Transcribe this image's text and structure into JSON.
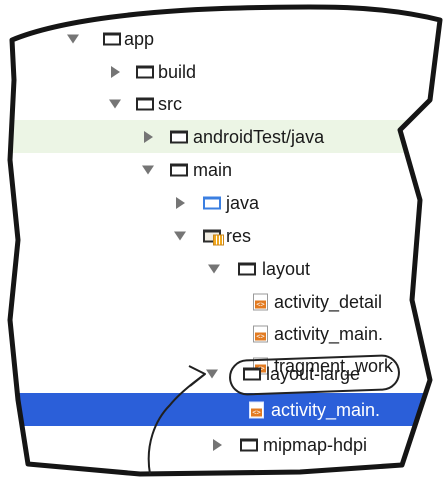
{
  "tree": {
    "items": [
      {
        "label": "app",
        "kind": "folder",
        "state": "expanded",
        "level": 0
      },
      {
        "label": "build",
        "kind": "folder",
        "state": "collapsed",
        "level": 1
      },
      {
        "label": "src",
        "kind": "folder",
        "state": "expanded",
        "level": 1
      },
      {
        "label": "androidTest/java",
        "kind": "folder",
        "state": "collapsed",
        "level": 2
      },
      {
        "label": "main",
        "kind": "folder",
        "state": "expanded",
        "level": 2
      },
      {
        "label": "java",
        "kind": "folder-java",
        "state": "collapsed",
        "level": 3
      },
      {
        "label": "res",
        "kind": "folder-res",
        "state": "expanded",
        "level": 3
      },
      {
        "label": "layout",
        "kind": "folder",
        "state": "expanded",
        "level": 4
      },
      {
        "label": "activity_detail",
        "kind": "layout-file",
        "state": "none",
        "level": 5
      },
      {
        "label": "activity_main.",
        "kind": "layout-file",
        "state": "none",
        "level": 5
      },
      {
        "label": "fragment_work",
        "kind": "layout-file",
        "state": "none",
        "level": 5
      },
      {
        "label": "layout-large",
        "kind": "folder",
        "state": "expanded",
        "level": 4,
        "circled": true
      },
      {
        "label": "activity_main.",
        "kind": "layout-file",
        "state": "none",
        "level": 5,
        "selected": true
      },
      {
        "label": "mipmap-hdpi",
        "kind": "folder",
        "state": "collapsed",
        "level": 4
      }
    ]
  },
  "colors": {
    "selection": "#2b5fd9",
    "module_band": "#ecf5e5",
    "java_folder": "#3b7fe1",
    "xml_badge": "#e27b22",
    "arrow": "#757575"
  },
  "icons": {
    "folder": "folder-icon",
    "java_folder": "java-folder-icon",
    "res_folder": "resources-folder-icon",
    "layout_file": "xml-layout-file-icon",
    "expand": "triangle-down-icon",
    "collapse": "triangle-right-icon"
  }
}
